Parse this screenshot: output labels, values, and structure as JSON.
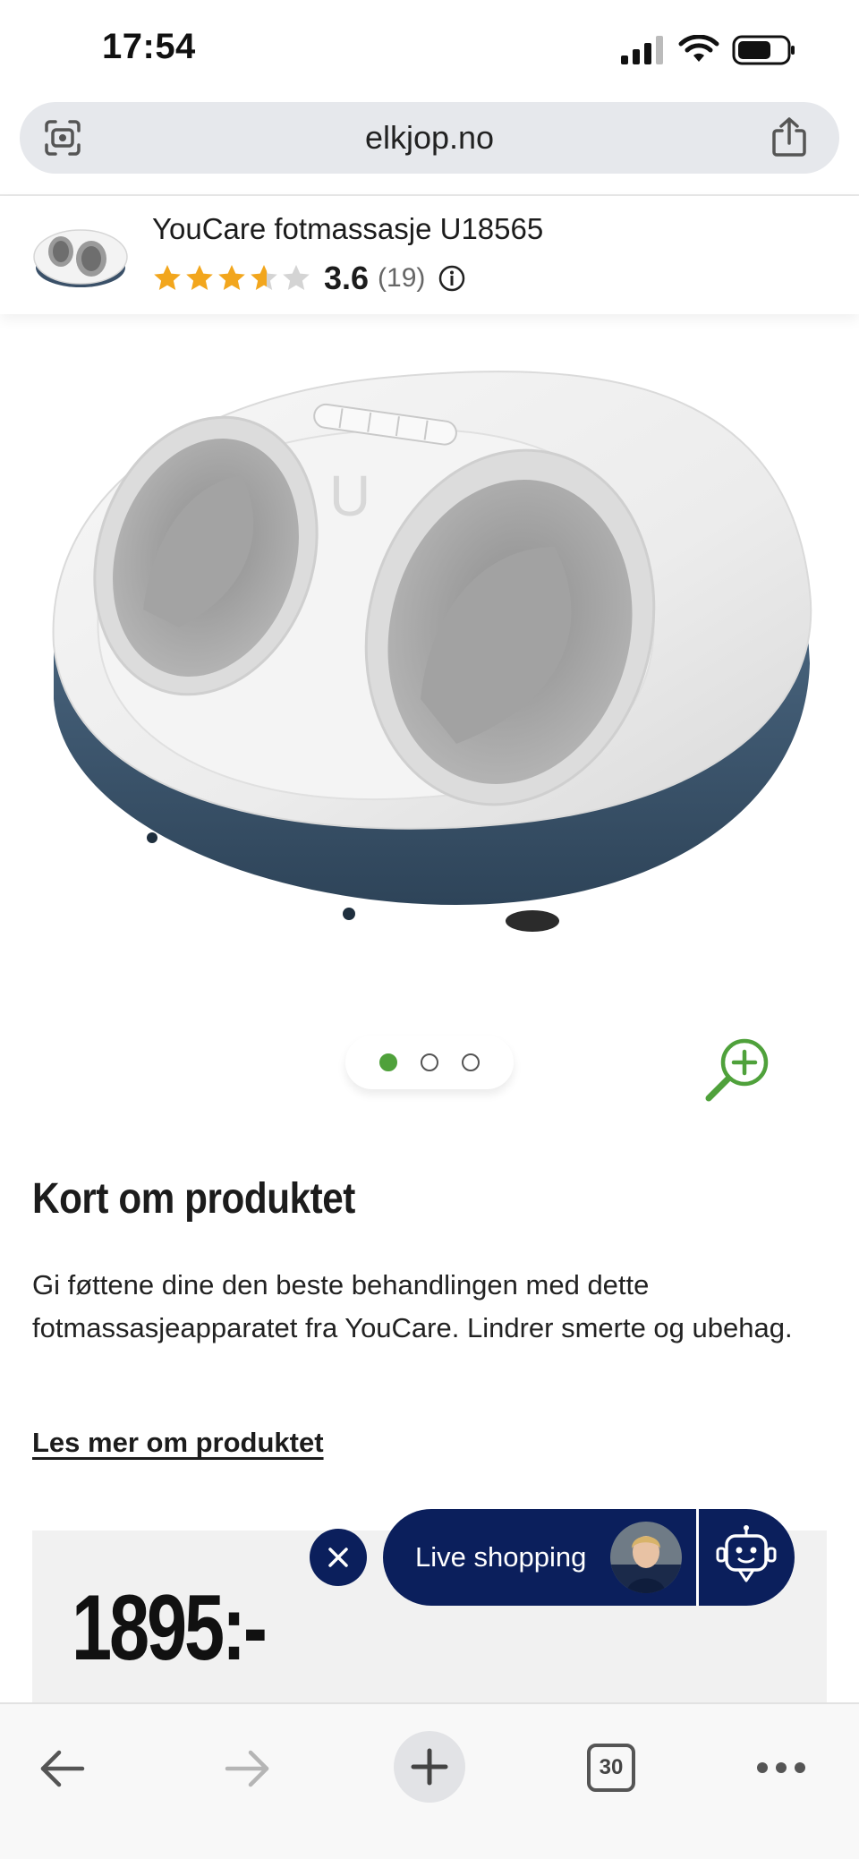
{
  "status_bar": {
    "time": "17:54",
    "icons": [
      "signal-icon",
      "wifi-icon",
      "battery-icon"
    ]
  },
  "browser": {
    "url": "elkjop.no",
    "tab_count": "30"
  },
  "product": {
    "name": "YouCare fotmassasje U18565",
    "rating": "3.6",
    "rating_fraction": 0.72,
    "review_count": "(19)",
    "image_count": 3,
    "active_image": 1,
    "logo_letter": "U"
  },
  "about": {
    "title": "Kort om produktet",
    "description": "Gi føttene dine den beste behandlingen med dette fotmassasjeapparatet fra YouCare. Lindrer smerte og ubehag.",
    "read_more": "Les mer om produktet"
  },
  "price": {
    "amount": "1895:-"
  },
  "live_shopping": {
    "label": "Live shopping"
  },
  "colors": {
    "accent_green": "#4fa13b",
    "navy": "#0b1f5c",
    "star": "#f2a61d"
  }
}
